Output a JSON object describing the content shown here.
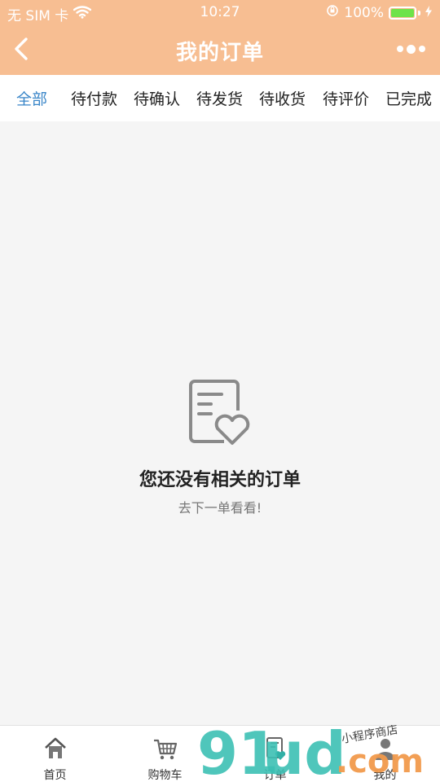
{
  "status_bar": {
    "carrier": "无 SIM 卡",
    "time": "10:27",
    "battery": "100%"
  },
  "nav": {
    "title": "我的订单"
  },
  "tabs": [
    {
      "label": "全部",
      "active": true
    },
    {
      "label": "待付款"
    },
    {
      "label": "待确认"
    },
    {
      "label": "待发货"
    },
    {
      "label": "待收货"
    },
    {
      "label": "待评价"
    },
    {
      "label": "已完成"
    }
  ],
  "empty": {
    "title": "您还没有相关的订单",
    "subtitle": "去下一单看看!"
  },
  "tabbar": [
    {
      "label": "首页",
      "icon": "home-icon"
    },
    {
      "label": "购物车",
      "icon": "cart-icon"
    },
    {
      "label": "订单",
      "icon": "order-icon"
    },
    {
      "label": "我的",
      "icon": "user-icon"
    }
  ],
  "watermark": {
    "brand": "91ud.com",
    "tagline": "小程序商店"
  },
  "colors": {
    "header": "#f7be92",
    "active_tab": "#3a86c8",
    "background": "#f5f5f5"
  }
}
